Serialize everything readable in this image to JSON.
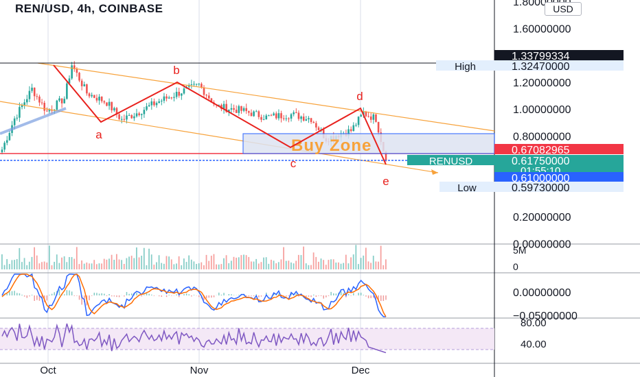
{
  "header": {
    "title": "REN/USD, 4h, COINBASE",
    "currency_button": "USD"
  },
  "chart_data": [
    {
      "type": "candlestick",
      "title": "REN/USD, 4h, COINBASE",
      "y_ticks": [
        {
          "value": 1.8,
          "label": "1.80000000"
        },
        {
          "value": 1.6,
          "label": "1.60000000"
        },
        {
          "value": 1.2,
          "label": "1.20000000"
        },
        {
          "value": 1.0,
          "label": "1.00000000"
        },
        {
          "value": 0.8,
          "label": "0.80000000"
        },
        {
          "value": 0.2,
          "label": "0.20000000"
        },
        {
          "value": 0.0,
          "label": "0.00000000"
        }
      ],
      "x_ticks": [
        "Oct",
        "Nov",
        "Dec"
      ],
      "price_tags": [
        {
          "label": "",
          "value": "1.33799334",
          "color": "#131722"
        },
        {
          "label": "High",
          "value": "1.32470000",
          "color": "#e3effd"
        },
        {
          "label": "",
          "value": "0.67082965",
          "color": "#f23645"
        },
        {
          "label": "RENUSD",
          "value": "0.61750000",
          "countdown": "01:55:10",
          "color": "#26a69a"
        },
        {
          "label": "",
          "value": "0.61000000",
          "color": "#2962ff"
        },
        {
          "label": "Low",
          "value": "0.59730000",
          "color": "#e3effd"
        }
      ],
      "wave_labels": [
        "a",
        "b",
        "c",
        "d",
        "e"
      ],
      "buy_zone_label": "Buy Zone",
      "wave_points": [
        {
          "x": "Sep 29",
          "y": 1.33
        },
        {
          "x": "Oct 6",
          "y": 0.9
        },
        {
          "x": "Oct 17",
          "y": 1.2
        },
        {
          "x": "Nov 17",
          "y": 0.73
        },
        {
          "x": "Dec 2",
          "y": 1.01
        },
        {
          "x": "Dec 7",
          "y": 0.58
        }
      ]
    },
    {
      "type": "bar",
      "name": "Volume",
      "y_ticks": [
        {
          "value": 5,
          "label": "5M"
        },
        {
          "value": 0,
          "label": "0"
        }
      ]
    },
    {
      "type": "line",
      "name": "MACD",
      "y_ticks": [
        {
          "value": 0.0,
          "label": "0.00000000"
        },
        {
          "value": -0.05,
          "label": "−0.05000000"
        }
      ]
    },
    {
      "type": "line",
      "name": "RSI",
      "y_ticks": [
        {
          "value": 80,
          "label": "80.00"
        },
        {
          "value": 40,
          "label": "40.00"
        }
      ]
    }
  ]
}
